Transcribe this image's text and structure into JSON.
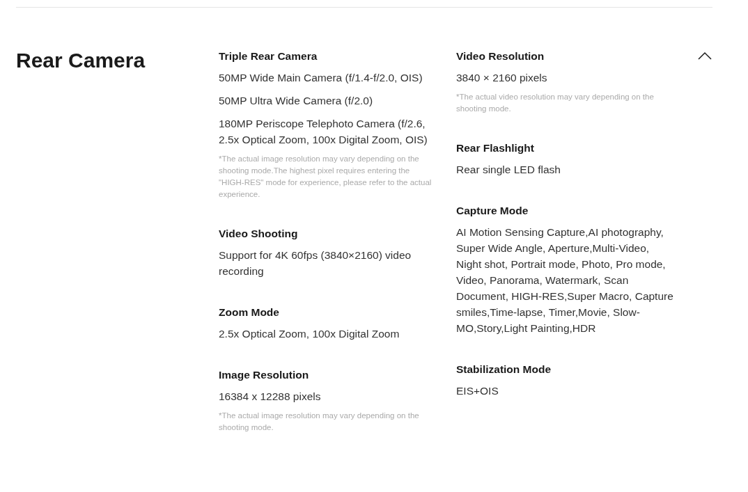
{
  "section": {
    "title": "Rear Camera",
    "expanded": true,
    "columns": [
      [
        {
          "title": "Triple Rear Camera",
          "values": [
            "50MP Wide Main Camera (f/1.4-f/2.0, OIS)",
            "50MP Ultra Wide Camera (f/2.0)",
            "180MP Periscope Telephoto Camera (f/2.6, 2.5x Optical Zoom, 100x Digital Zoom, OIS)"
          ],
          "note": "*The actual image resolution may vary depending on the shooting mode.The highest pixel requires entering the \"HIGH-RES\" mode for experience, please refer to the actual experience."
        },
        {
          "title": "Video Shooting",
          "values": [
            "Support for 4K 60fps (3840×2160) video recording"
          ]
        },
        {
          "title": "Zoom Mode",
          "values": [
            "2.5x Optical Zoom, 100x Digital Zoom"
          ]
        },
        {
          "title": "Image Resolution",
          "values": [
            "16384 x 12288 pixels"
          ],
          "note": "*The actual image resolution may vary depending on the shooting mode."
        }
      ],
      [
        {
          "title": "Video Resolution",
          "values": [
            "3840 × 2160 pixels"
          ],
          "note": "*The actual video resolution may vary depending on the shooting mode."
        },
        {
          "title": "Rear Flashlight",
          "values": [
            "Rear single LED flash"
          ]
        },
        {
          "title": "Capture Mode",
          "values": [
            "AI Motion Sensing Capture,AI photography, Super Wide Angle, Aperture,Multi-Video, Night shot, Portrait mode, Photo, Pro mode, Video, Panorama, Watermark, Scan Document, HIGH-RES,Super Macro, Capture smiles,Time-lapse, Timer,Movie, Slow-MO,Story,Light Painting,HDR"
          ]
        },
        {
          "title": "Stabilization Mode",
          "values": [
            "EIS+OIS"
          ]
        }
      ]
    ]
  }
}
